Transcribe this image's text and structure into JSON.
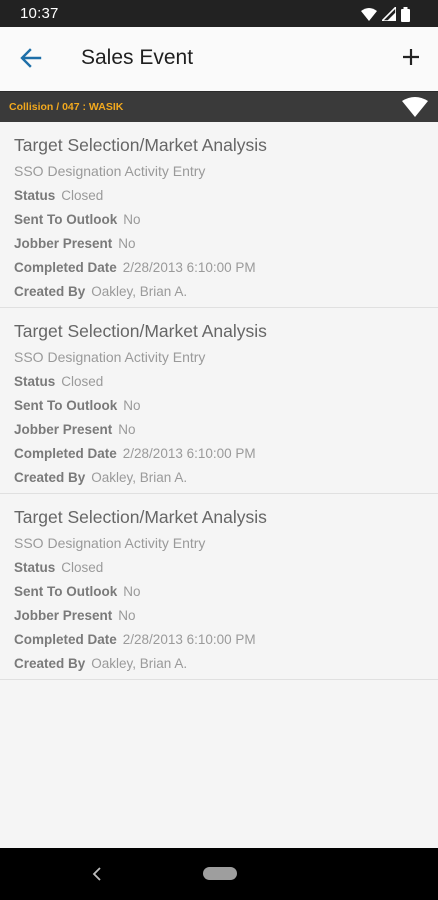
{
  "status_bar": {
    "time": "10:37"
  },
  "app_bar": {
    "title": "Sales Event"
  },
  "context": {
    "label": "Collision / 047 : WASIK"
  },
  "events": [
    {
      "title": "Target Selection/Market Analysis",
      "subtitle": "SSO Designation Activity Entry",
      "fields": [
        {
          "label": "Status",
          "value": "Closed"
        },
        {
          "label": "Sent To Outlook",
          "value": "No"
        },
        {
          "label": "Jobber Present",
          "value": "No"
        },
        {
          "label": "Completed Date",
          "value": "2/28/2013 6:10:00 PM"
        },
        {
          "label": "Created By",
          "value": "Oakley, Brian A."
        }
      ]
    },
    {
      "title": "Target Selection/Market Analysis",
      "subtitle": "SSO Designation Activity Entry",
      "fields": [
        {
          "label": "Status",
          "value": "Closed"
        },
        {
          "label": "Sent To Outlook",
          "value": "No"
        },
        {
          "label": "Jobber Present",
          "value": "No"
        },
        {
          "label": "Completed Date",
          "value": "2/28/2013 6:10:00 PM"
        },
        {
          "label": "Created By",
          "value": "Oakley, Brian A."
        }
      ]
    },
    {
      "title": "Target Selection/Market Analysis",
      "subtitle": "SSO Designation Activity Entry",
      "fields": [
        {
          "label": "Status",
          "value": "Closed"
        },
        {
          "label": "Sent To Outlook",
          "value": "No"
        },
        {
          "label": "Jobber Present",
          "value": "No"
        },
        {
          "label": "Completed Date",
          "value": "2/28/2013 6:10:00 PM"
        },
        {
          "label": "Created By",
          "value": "Oakley, Brian A."
        }
      ]
    }
  ],
  "icons": {
    "back": "arrow-left-icon",
    "add": "plus-icon",
    "wifi": "wifi-icon",
    "signal": "signal-icon",
    "battery": "battery-icon",
    "nav_back": "chevron-left-icon",
    "nav_home": "home-pill-icon"
  },
  "colors": {
    "accent": "#1e6fa8",
    "context_text": "#f2a91e",
    "context_bg": "#3a3a3a",
    "status_bar_bg": "#222222",
    "nav_bar_bg": "#000000"
  }
}
